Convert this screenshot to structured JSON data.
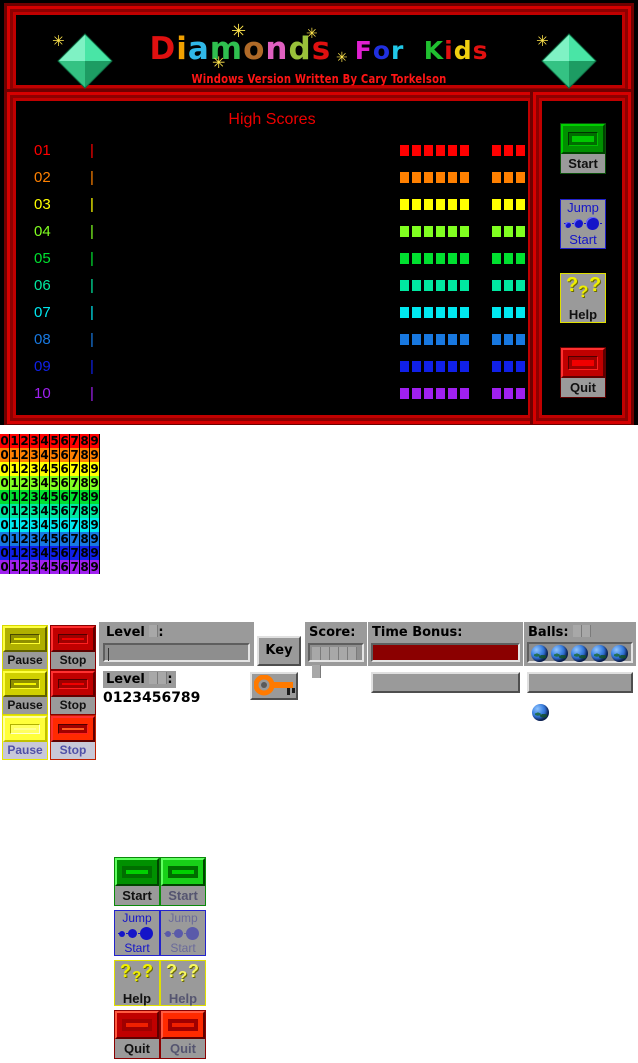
{
  "app": {
    "title_words": [
      {
        "text": "D",
        "color": "#e01010"
      },
      {
        "text": "i",
        "color": "#f0a000"
      },
      {
        "text": "a",
        "color": "#30b8e8"
      },
      {
        "text": "m",
        "color": "#2fbf4f"
      },
      {
        "text": "o",
        "color": "#b06a28"
      },
      {
        "text": "n",
        "color": "#e060c0"
      },
      {
        "text": "d",
        "color": "#9ac13a"
      },
      {
        "text": "s",
        "color": "#e01010"
      },
      {
        "text": " ",
        "color": "#000000"
      },
      {
        "text": "F",
        "color": "#e020d0"
      },
      {
        "text": "o",
        "color": "#2030e0"
      },
      {
        "text": "r",
        "color": "#20c8e8"
      },
      {
        "text": " ",
        "color": "#000000"
      },
      {
        "text": "K",
        "color": "#20c030"
      },
      {
        "text": "i",
        "color": "#e01010"
      },
      {
        "text": "d",
        "color": "#f0d010"
      },
      {
        "text": "s",
        "color": "#e01010"
      }
    ],
    "title_plain": "Diamonds For Kids",
    "subtitle": "Windows Version Written By Cary Torkelson",
    "frame_color": "#c00000",
    "diamond_color": "#32d78f"
  },
  "high_scores": {
    "heading": "High Scores",
    "heading_color": "#ee0000",
    "separator": "|",
    "rows": [
      {
        "rank": "01",
        "color": "#ff0000",
        "name_blocks": 6,
        "score_blocks": 3
      },
      {
        "rank": "02",
        "color": "#ff8000",
        "name_blocks": 6,
        "score_blocks": 3
      },
      {
        "rank": "03",
        "color": "#ffff00",
        "name_blocks": 6,
        "score_blocks": 3
      },
      {
        "rank": "04",
        "color": "#80ff20",
        "name_blocks": 6,
        "score_blocks": 3
      },
      {
        "rank": "05",
        "color": "#00e030",
        "name_blocks": 6,
        "score_blocks": 3
      },
      {
        "rank": "06",
        "color": "#00e8a0",
        "name_blocks": 6,
        "score_blocks": 3
      },
      {
        "rank": "07",
        "color": "#00e8f0",
        "name_blocks": 6,
        "score_blocks": 3
      },
      {
        "rank": "08",
        "color": "#1878e0",
        "name_blocks": 6,
        "score_blocks": 3
      },
      {
        "rank": "09",
        "color": "#1020e8",
        "name_blocks": 6,
        "score_blocks": 3
      },
      {
        "rank": "10",
        "color": "#a020f0",
        "name_blocks": 6,
        "score_blocks": 3
      }
    ]
  },
  "buttons": {
    "start": {
      "label": "Start",
      "icon": "green-bar-icon",
      "border": "#0a4f0a"
    },
    "jump_start": {
      "line1": "Jump",
      "line2": "Start",
      "icon": "blue-balls-icon",
      "border": "#2222cc"
    },
    "help": {
      "label": "Help",
      "icon": "question-marks-icon",
      "border": "#e0e000"
    },
    "quit": {
      "label": "Quit",
      "icon": "red-bar-icon",
      "border": "#5f0000"
    }
  },
  "sprites": {
    "digits": "0123456789",
    "digit_row_colors": [
      "#ff0000",
      "#ff8000",
      "#ffff00",
      "#80ff20",
      "#00e030",
      "#00e8a0",
      "#00e8f0",
      "#1878e0",
      "#1020e8",
      "#a020f0"
    ],
    "button_variants": [
      "normal",
      "highlight"
    ],
    "sheet_buttons": [
      {
        "name": "start",
        "label": "Start"
      },
      {
        "name": "jump-start",
        "line1": "Jump",
        "line2": "Start"
      },
      {
        "name": "help",
        "label": "Help"
      },
      {
        "name": "quit",
        "label": "Quit"
      }
    ]
  },
  "status_bar": {
    "pause_label": "Pause",
    "stop_label": "Stop",
    "level_label_1": "Level",
    "level_label_2": "Level",
    "level_colon": ":",
    "level_value_blocks_1": 1,
    "level_value_blocks_2": 2,
    "level_digits": "0123456789",
    "level_input_value": "",
    "key_button_label": "Key",
    "key_icon": "orange-key-icon",
    "score_label": "Score:",
    "score_blocks": 6,
    "time_bonus_label": "Time Bonus:",
    "time_bonus_fill_percent": 100,
    "time_bonus_color": "#8b0000",
    "balls_label": "Balls:",
    "balls_value_blocks": 2,
    "balls_count": 5,
    "ball_icon": "blue-ball-icon"
  }
}
